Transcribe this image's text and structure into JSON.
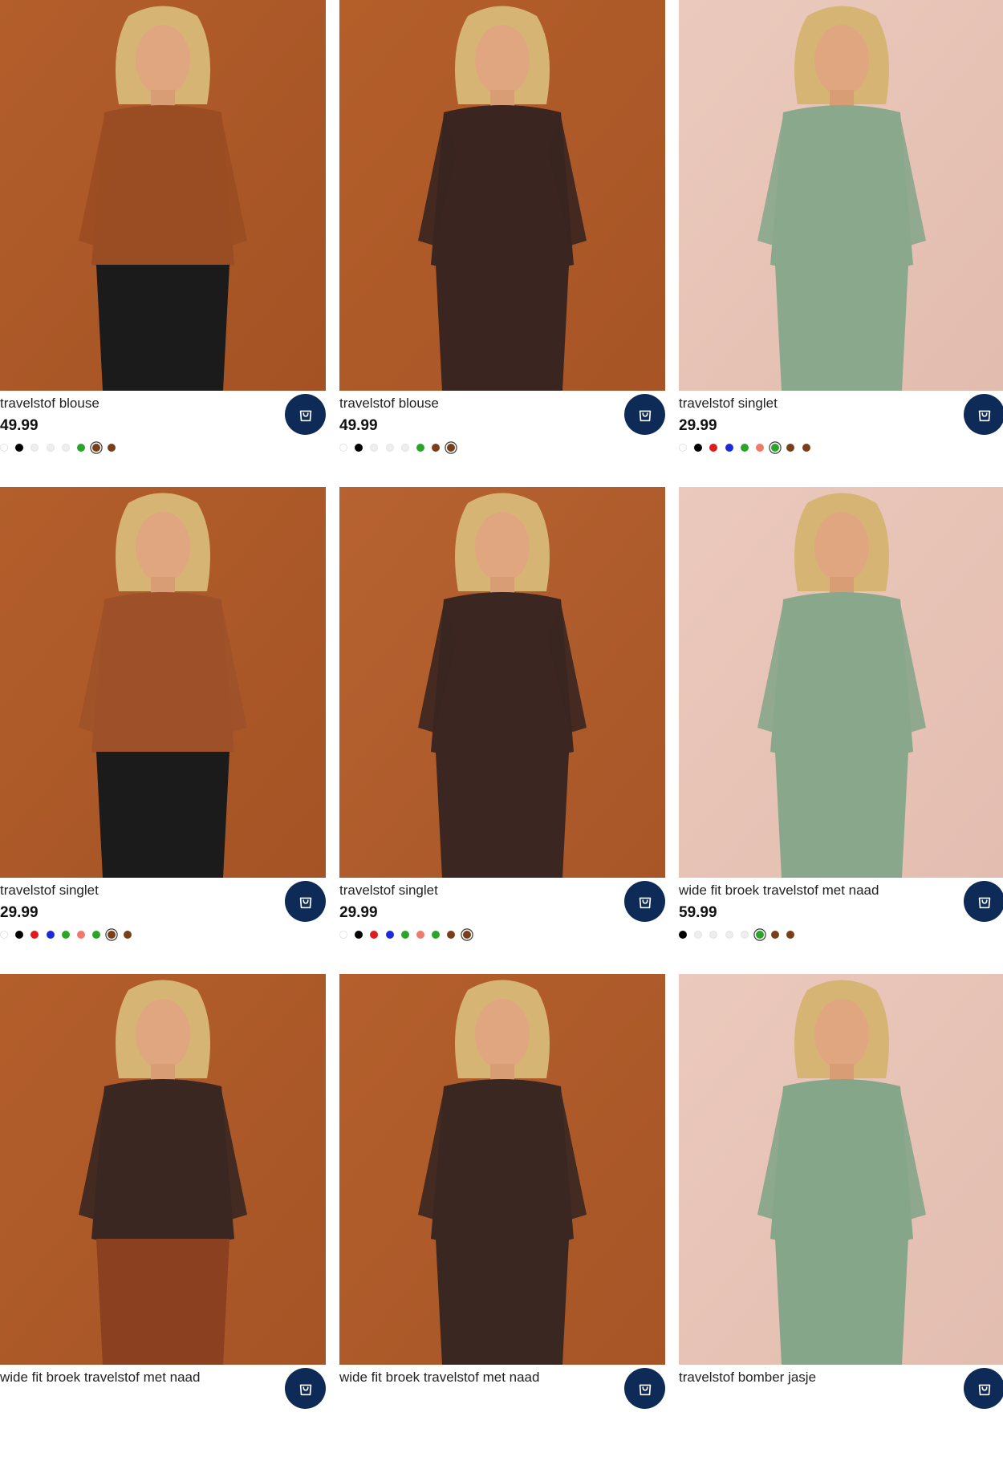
{
  "icons": {
    "cart_button": "shopping-bag-icon"
  },
  "colors": {
    "cart_button_bg": "#0e2a56"
  },
  "products": [
    {
      "name": "travelstof blouse",
      "price": "49.99",
      "swatches": [
        {
          "c": "#ffffff"
        },
        {
          "c": "#000000"
        },
        {
          "c": "#eeeeee"
        },
        {
          "c": "#eeeeee"
        },
        {
          "c": "#eeeeee"
        },
        {
          "c": "#2aa52a"
        },
        {
          "c": "#7a3f19",
          "sel": true
        },
        {
          "c": "#7a3f19"
        }
      ]
    },
    {
      "name": "travelstof blouse",
      "price": "49.99",
      "swatches": [
        {
          "c": "#ffffff"
        },
        {
          "c": "#000000"
        },
        {
          "c": "#eeeeee"
        },
        {
          "c": "#eeeeee"
        },
        {
          "c": "#eeeeee"
        },
        {
          "c": "#2aa52a"
        },
        {
          "c": "#7a3f19"
        },
        {
          "c": "#7a3f19",
          "sel": true
        }
      ]
    },
    {
      "name": "travelstof singlet",
      "price": "29.99",
      "swatches": [
        {
          "c": "#ffffff"
        },
        {
          "c": "#000000"
        },
        {
          "c": "#e01b1b"
        },
        {
          "c": "#1c2bd9"
        },
        {
          "c": "#2aa52a"
        },
        {
          "c": "#f07a6a"
        },
        {
          "c": "#2aa52a",
          "sel": true
        },
        {
          "c": "#7a3f19"
        },
        {
          "c": "#7a3f19"
        }
      ]
    },
    {
      "name": "travelstof singlet",
      "price": "29.99",
      "swatches": [
        {
          "c": "#ffffff"
        },
        {
          "c": "#000000"
        },
        {
          "c": "#e01b1b"
        },
        {
          "c": "#1c2bd9"
        },
        {
          "c": "#2aa52a"
        },
        {
          "c": "#f07a6a"
        },
        {
          "c": "#2aa52a"
        },
        {
          "c": "#7a3f19",
          "sel": true
        },
        {
          "c": "#7a3f19"
        }
      ]
    },
    {
      "name": "travelstof singlet",
      "price": "29.99",
      "swatches": [
        {
          "c": "#ffffff"
        },
        {
          "c": "#000000"
        },
        {
          "c": "#e01b1b"
        },
        {
          "c": "#1c2bd9"
        },
        {
          "c": "#2aa52a"
        },
        {
          "c": "#f07a6a"
        },
        {
          "c": "#2aa52a"
        },
        {
          "c": "#7a3f19"
        },
        {
          "c": "#7a3f19",
          "sel": true
        }
      ]
    },
    {
      "name": "wide fit broek travelstof met naad",
      "price": "59.99",
      "swatches": [
        {
          "c": "#000000"
        },
        {
          "c": "#eeeeee"
        },
        {
          "c": "#eeeeee"
        },
        {
          "c": "#eeeeee"
        },
        {
          "c": "#eeeeee"
        },
        {
          "c": "#2aa52a",
          "sel": true
        },
        {
          "c": "#7a3f19"
        },
        {
          "c": "#7a3f19"
        }
      ]
    },
    {
      "name": "wide fit broek travelstof met naad",
      "price": "",
      "swatches": []
    },
    {
      "name": "wide fit broek travelstof met naad",
      "price": "",
      "swatches": []
    },
    {
      "name": "travelstof bomber jasje",
      "price": "",
      "swatches": []
    }
  ],
  "photos": [
    {
      "bg": "#b35e2b",
      "bg2": "#a45224",
      "garment": "#9a4d22",
      "bottom": "#1b1b1b",
      "icon": "model-photo-icon"
    },
    {
      "bg": "#b45f2a",
      "bg2": "#a75426",
      "garment": "#3a2520",
      "bottom": "#3a2520",
      "icon": "model-photo-icon"
    },
    {
      "bg": "#ebcabd",
      "bg2": "#e2bcae",
      "garment": "#8aa88c",
      "bottom": "#8aa88c",
      "icon": "model-photo-icon"
    },
    {
      "bg": "#b35e2b",
      "bg2": "#a55325",
      "garment": "#9e5129",
      "bottom": "#1b1b1b",
      "icon": "model-photo-icon"
    },
    {
      "bg": "#b76230",
      "bg2": "#a85628",
      "garment": "#3b2621",
      "bottom": "#3b2621",
      "icon": "model-photo-icon"
    },
    {
      "bg": "#ebc9bc",
      "bg2": "#e3bdb0",
      "garment": "#89a78b",
      "bottom": "#89a78b",
      "icon": "model-photo-icon"
    },
    {
      "bg": "#b35e2b",
      "bg2": "#a65426",
      "garment": "#3b2722",
      "bottom": "#8b4020",
      "icon": "model-photo-icon"
    },
    {
      "bg": "#b45f2c",
      "bg2": "#a75527",
      "garment": "#3b2722",
      "bottom": "#3b2722",
      "icon": "model-photo-icon"
    },
    {
      "bg": "#ebc9bc",
      "bg2": "#e2bdb0",
      "garment": "#86a689",
      "bottom": "#86a689",
      "icon": "model-photo-icon"
    }
  ]
}
